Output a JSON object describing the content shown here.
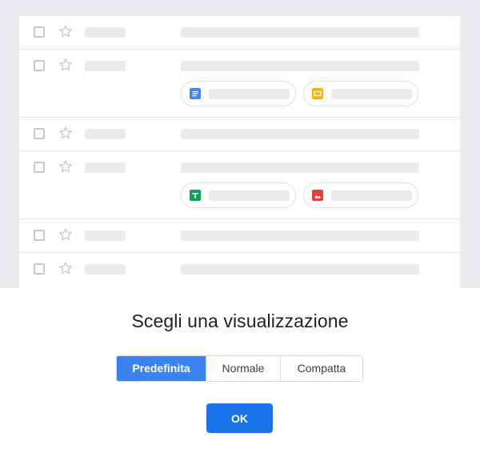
{
  "dialog": {
    "title": "Scegli una visualizzazione",
    "options": [
      {
        "label": "Predefinita",
        "selected": true
      },
      {
        "label": "Normale",
        "selected": false
      },
      {
        "label": "Compatta",
        "selected": false
      }
    ],
    "ok_label": "OK"
  },
  "inbox_preview": {
    "rows": [
      {
        "type": "short",
        "attachments": []
      },
      {
        "type": "tall",
        "attachments": [
          "docs-icon",
          "slides-icon"
        ]
      },
      {
        "type": "short",
        "attachments": []
      },
      {
        "type": "tall",
        "attachments": [
          "sheets-icon",
          "image-icon"
        ]
      },
      {
        "type": "short",
        "attachments": []
      },
      {
        "type": "short",
        "attachments": []
      }
    ]
  },
  "colors": {
    "accent": "#3b82f1",
    "ok_button": "#1a73e8",
    "docs": "#4285f4",
    "slides": "#f4b400",
    "sheets": "#0f9d58",
    "image": "#db4437"
  }
}
